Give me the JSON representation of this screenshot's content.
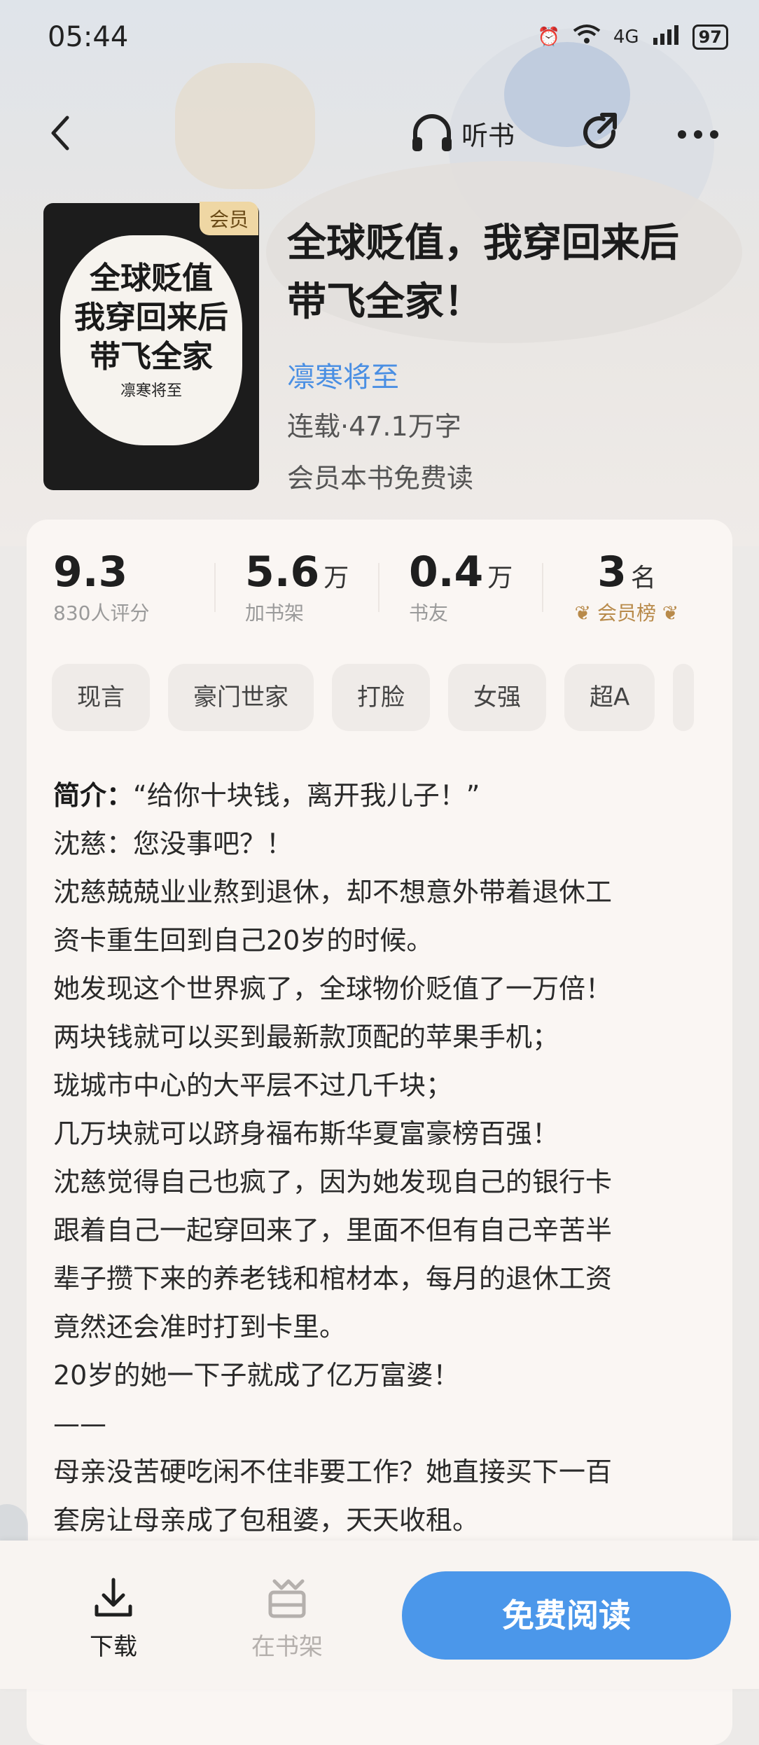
{
  "status": {
    "time": "05:44",
    "battery": "97",
    "network": "4G"
  },
  "nav": {
    "listen_label": "听书"
  },
  "book": {
    "vip_tag": "会员",
    "cover_title_line1": "全球贬值",
    "cover_title_line2": "我穿回来后",
    "cover_title_line3": "带飞全家",
    "cover_author": "凛寒将至",
    "title_line1": "全球贬值，我穿回来后",
    "title_line2": "带飞全家！",
    "author": "凛寒将至",
    "meta": "连载·47.1万字",
    "free_note": "会员本书免费读"
  },
  "stats": [
    {
      "value": "9.3",
      "unit": "",
      "label": "830人评分"
    },
    {
      "value": "5.6",
      "unit": "万",
      "label": "加书架"
    },
    {
      "value": "0.4",
      "unit": "万",
      "label": "书友"
    },
    {
      "value": "3",
      "unit": "名",
      "label": "会员榜"
    }
  ],
  "tags": [
    "现言",
    "豪门世家",
    "打脸",
    "女强",
    "超A"
  ],
  "intro": {
    "heading": "简介：",
    "first": "“给你十块钱，离开我儿子！”",
    "lines": [
      "沈慈：您没事吧？！",
      "沈慈兢兢业业熬到退休，却不想意外带着退休工",
      "资卡重生回到自己20岁的时候。",
      "她发现这个世界疯了，全球物价贬值了一万倍！",
      "两块钱就可以买到最新款顶配的苹果手机；",
      "珑城市中心的大平层不过几千块；",
      "几万块就可以跻身福布斯华夏富豪榜百强！",
      "沈慈觉得自己也疯了，因为她发现自己的银行卡",
      "跟着自己一起穿回来了，里面不但有自己辛苦半",
      "辈子攒下来的养老钱和棺材本，每月的退休工资",
      "竟然还会准时打到卡里。",
      "20岁的她一下子就成了亿万富婆！",
      "——",
      "母亲没苦硬吃闲不住非要工作？她直接买下一百",
      "套房让母亲成了包租婆，天天收租。"
    ]
  },
  "bottom": {
    "download": "下载",
    "shelf": "在书架",
    "read": "免费阅读"
  },
  "colors": {
    "accent": "#4b97ea",
    "author_link": "#4a8fe3",
    "vip_gold": "#efd7a4"
  }
}
